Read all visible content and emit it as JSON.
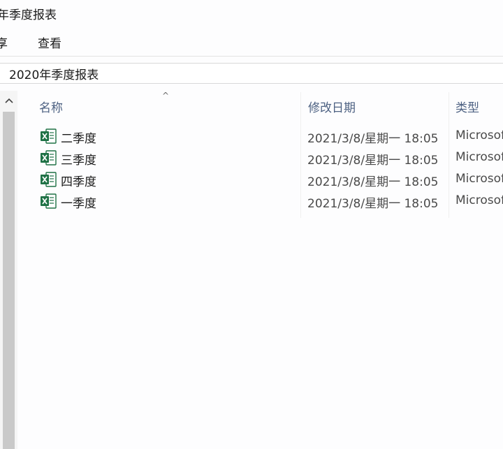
{
  "window": {
    "title": "年季度报表"
  },
  "ribbon": {
    "share_label": "享",
    "view_label": "查看"
  },
  "address": {
    "path": "2020年季度报表"
  },
  "list_header": {
    "sort_indicator": "^",
    "name": "名称",
    "date_modified": "修改日期",
    "type": "类型"
  },
  "files": [
    {
      "name": "二季度",
      "date": "2021/3/8/星期一 18:05",
      "type": "Microsoft"
    },
    {
      "name": "三季度",
      "date": "2021/3/8/星期一 18:05",
      "type": "Microsoft"
    },
    {
      "name": "四季度",
      "date": "2021/3/8/星期一 18:05",
      "type": "Microsoft"
    },
    {
      "name": "一季度",
      "date": "2021/3/8/星期一 18:05",
      "type": "Microsoft"
    }
  ],
  "colors": {
    "excel_green": "#1e7145",
    "header_text": "#4d6182"
  },
  "icons": {
    "file": "excel-file-icon",
    "scroll_up": "chevron-up-icon",
    "sort": "sort-ascending-icon"
  }
}
